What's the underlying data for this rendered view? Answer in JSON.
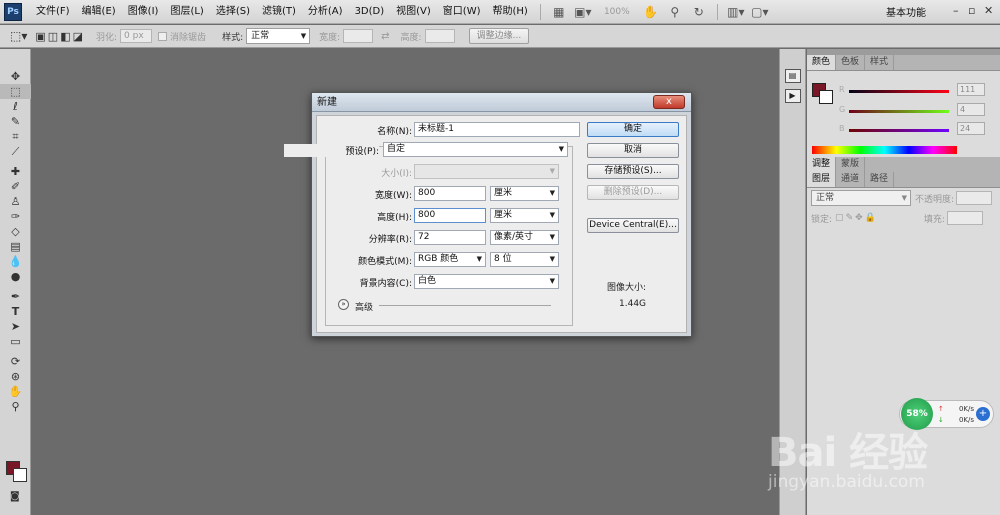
{
  "app": {
    "logo": "Ps"
  },
  "menubar": {
    "items": [
      "文件(F)",
      "编辑(E)",
      "图像(I)",
      "图层(L)",
      "选择(S)",
      "滤镜(T)",
      "分析(A)",
      "3D(D)",
      "视图(V)",
      "窗口(W)",
      "帮助(H)"
    ],
    "zoom": "100%",
    "workspace": "基本功能"
  },
  "options": {
    "feather_label": "羽化:",
    "feather_value": "0 px",
    "antialias_label": "消除锯齿",
    "style_label": "样式:",
    "style_value": "正常",
    "width_label": "宽度:",
    "height_label": "高度:",
    "refine_button": "调整边缘..."
  },
  "colors": {
    "foreground": "#7a1726",
    "background": "#ffffff"
  },
  "color_panel": {
    "tabs": [
      "颜色",
      "色板",
      "样式"
    ],
    "r_label": "R",
    "g_label": "G",
    "b_label": "B",
    "r": "111",
    "g": "4",
    "b": "24"
  },
  "adjust_tabs": [
    "调整",
    "蒙版"
  ],
  "layers_panel": {
    "tabs": [
      "图层",
      "通道",
      "路径"
    ],
    "blend_mode": "正常",
    "opacity_label": "不透明度:",
    "lock_label": "锁定:",
    "fill_label": "填充:"
  },
  "dialog": {
    "title": "新建",
    "close": "x",
    "name_label": "名称(N):",
    "name_value": "未标题-1",
    "preset_label": "预设(P):",
    "preset_value": "自定",
    "size_label": "大小(I):",
    "width_label": "宽度(W):",
    "width_value": "800",
    "width_unit": "厘米",
    "height_label": "高度(H):",
    "height_value": "800",
    "height_unit": "厘米",
    "resolution_label": "分辨率(R):",
    "resolution_value": "72",
    "resolution_unit": "像素/英寸",
    "color_mode_label": "颜色模式(M):",
    "color_mode_value": "RGB 颜色",
    "bit_depth_value": "8 位",
    "bg_contents_label": "背景内容(C):",
    "bg_contents_value": "白色",
    "advanced_label": "高级",
    "ok_button": "确定",
    "cancel_button": "取消",
    "save_preset_button": "存储预设(S)...",
    "delete_preset_button": "删除预设(D)...",
    "device_central_button": "Device Central(E)...",
    "image_size_label": "图像大小:",
    "image_size_value": "1.44G"
  },
  "network_widget": {
    "percent": "58%",
    "up_rate": "0K/s",
    "down_rate": "0K/s"
  },
  "watermark": {
    "logo": "Bai 经验",
    "url": "jingyan.baidu.com"
  }
}
